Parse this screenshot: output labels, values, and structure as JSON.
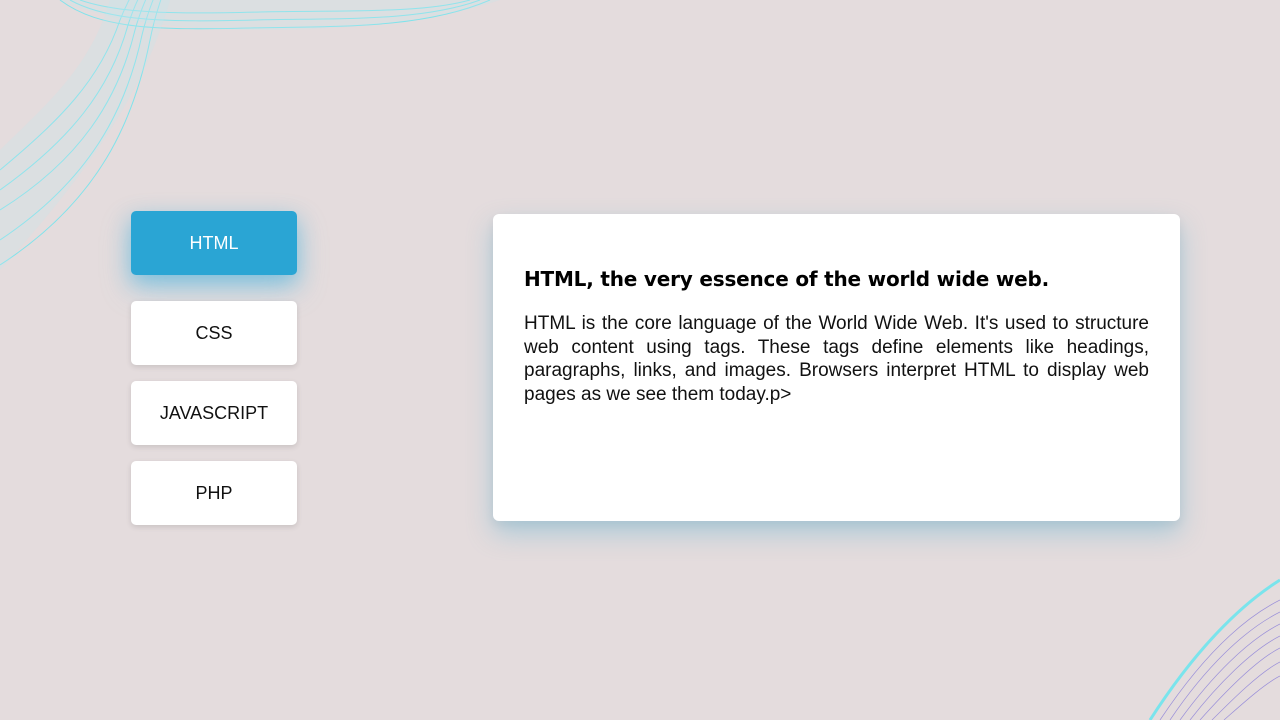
{
  "tabs": [
    {
      "label": "HTML",
      "active": true
    },
    {
      "label": "CSS",
      "active": false
    },
    {
      "label": "JAVASCRIPT",
      "active": false
    },
    {
      "label": "PHP",
      "active": false
    }
  ],
  "content": {
    "title": "HTML, the very essence of the world wide web.",
    "body": "HTML is the core language of the World Wide Web. It's used to structure web content using tags. These tags define elements like headings, paragraphs, links, and images. Browsers interpret HTML to display web pages as we see them today.p>"
  },
  "colors": {
    "background": "#e4dcdd",
    "active_tab": "#2aa5d4",
    "card": "#ffffff",
    "decor_cyan": "#5fe6f0",
    "decor_violet": "#7b6fd8"
  }
}
